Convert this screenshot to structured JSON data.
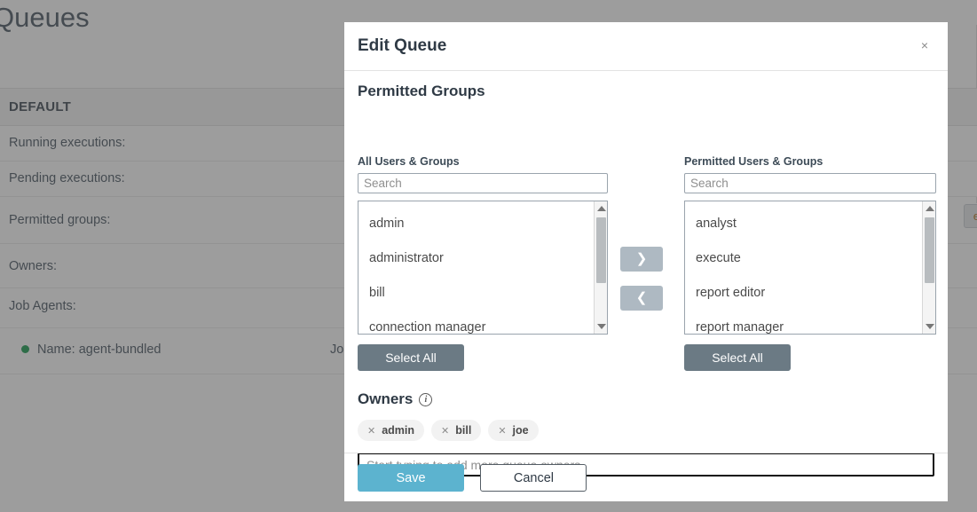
{
  "background": {
    "page_title": "Queues",
    "section_header": "DEFAULT",
    "properties": [
      {
        "label": "Running executions:"
      },
      {
        "label": "Pending executions:"
      },
      {
        "label": "Permitted groups:"
      },
      {
        "label": "Owners:"
      },
      {
        "label": "Job Agents:"
      }
    ],
    "agent": {
      "name": "Name: agent-bundled",
      "job_fragment": "Job"
    },
    "edge_button": "e"
  },
  "modal": {
    "title": "Edit Queue",
    "close_label": "×",
    "permitted_groups_heading": "Permitted Groups",
    "left_panel": {
      "label": "All Users & Groups",
      "search_placeholder": "Search",
      "search_value": "",
      "items": [
        "admin",
        "administrator",
        "bill",
        "connection manager"
      ],
      "select_all_label": "Select All"
    },
    "right_panel": {
      "label": "Permitted Users & Groups",
      "search_placeholder": "Search",
      "search_value": "",
      "items": [
        "analyst",
        "execute",
        "report editor",
        "report manager"
      ],
      "select_all_label": "Select All"
    },
    "transfer": {
      "add_label": "❯",
      "remove_label": "❮"
    },
    "owners": {
      "heading": "Owners",
      "info_label": "i",
      "chips": [
        "admin",
        "bill",
        "joe"
      ],
      "chip_remove_label": "✕",
      "input_placeholder": "Start typing to add more queue owners",
      "input_value": ""
    },
    "footer": {
      "save_label": "Save",
      "cancel_label": "Cancel"
    }
  },
  "colors": {
    "accent_save": "#5cb3cf",
    "select_all": "#6b7a84",
    "transfer_button": "#aeb9c2",
    "status_dot": "#0b9444",
    "text_dark": "#2f3a45"
  }
}
